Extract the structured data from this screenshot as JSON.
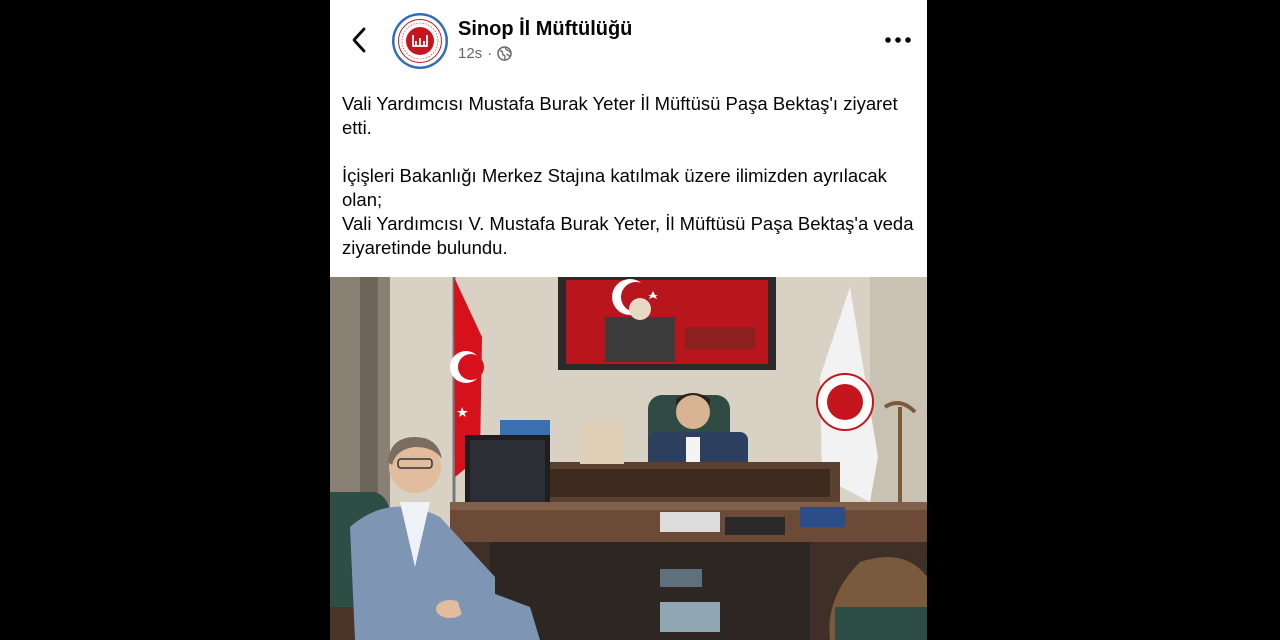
{
  "post": {
    "page_name": "Sinop İl Müftülüğü",
    "time": "12s",
    "separator": "·",
    "privacy_icon": "globe-icon",
    "back_icon": "chevron-left-icon",
    "more_icon": "more-dots-icon",
    "paragraphs": [
      "Vali Yardımcısı Mustafa Burak Yeter İl Müftüsü Paşa Bektaş'ı ziyaret etti.",
      "İçişleri Bakanlığı Merkez Stajına katılmak üzere ilimizden ayrılacak olan;"
    ],
    "line_3": "Vali Yardımcısı V. Mustafa Burak Yeter, İl Müftüsü Paşa Bektaş'a veda ziyaretinde bulundu."
  },
  "colors": {
    "background": "#000000",
    "card": "#ffffff",
    "text": "#050505",
    "secondary_text": "#65676b",
    "avatar_ring": "#2f6db8",
    "avatar_logo": "#c4161c"
  }
}
